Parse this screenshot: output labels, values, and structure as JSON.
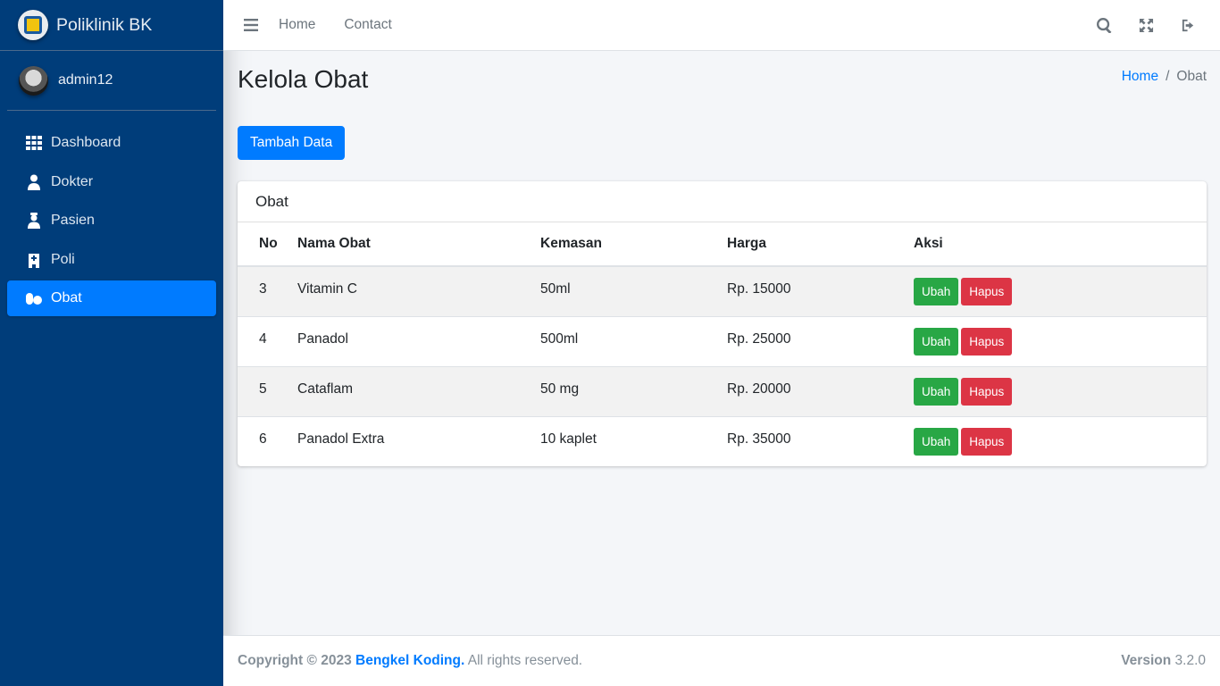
{
  "brand": {
    "name": "Poliklinik BK"
  },
  "user": {
    "name": "admin12"
  },
  "sidebar": {
    "items": [
      {
        "label": "Dashboard",
        "icon": "grid-icon"
      },
      {
        "label": "Dokter",
        "icon": "doctor-icon"
      },
      {
        "label": "Pasien",
        "icon": "patient-icon"
      },
      {
        "label": "Poli",
        "icon": "hospital-icon"
      },
      {
        "label": "Obat",
        "icon": "pills-icon",
        "active": true
      }
    ]
  },
  "topbar": {
    "home": "Home",
    "contact": "Contact"
  },
  "page": {
    "title": "Kelola Obat",
    "add_button": "Tambah Data"
  },
  "breadcrumb": {
    "home": "Home",
    "sep": "/",
    "current": "Obat"
  },
  "card": {
    "title": "Obat"
  },
  "table": {
    "headers": [
      "No",
      "Nama Obat",
      "Kemasan",
      "Harga",
      "Aksi"
    ],
    "rows": [
      {
        "no": "3",
        "nama": "Vitamin C",
        "kemasan": "50ml",
        "harga": "Rp. 15000"
      },
      {
        "no": "4",
        "nama": "Panadol",
        "kemasan": "500ml",
        "harga": "Rp. 25000"
      },
      {
        "no": "5",
        "nama": "Cataflam",
        "kemasan": "50 mg",
        "harga": "Rp. 20000"
      },
      {
        "no": "6",
        "nama": "Panadol Extra",
        "kemasan": "10 kaplet",
        "harga": "Rp. 35000"
      }
    ],
    "edit_label": "Ubah",
    "delete_label": "Hapus"
  },
  "footer": {
    "copyright": "Copyright © 2023",
    "company": "Bengkel Koding.",
    "rights": "All rights reserved.",
    "version_label": "Version",
    "version": "3.2.0"
  },
  "colors": {
    "sidebar": "#003d7a",
    "primary": "#007bff",
    "success": "#28a745",
    "danger": "#dc3545"
  }
}
